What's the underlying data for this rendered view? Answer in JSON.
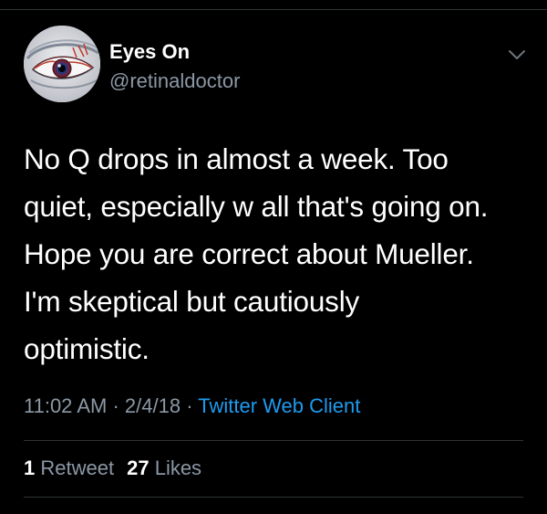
{
  "author": {
    "display_name": "Eyes On",
    "handle": "@retinaldoctor",
    "avatar_icon": "eye-avatar-icon"
  },
  "tweet": {
    "text_lines": [
      "No Q drops in almost a week. Too",
      "quiet, especially w all that's going on.",
      "Hope you are correct about Mueller.",
      "I'm skeptical but cautiously",
      "optimistic."
    ],
    "time": "11:02 AM",
    "date": "2/4/18",
    "separator": "·",
    "client": "Twitter Web Client"
  },
  "stats": {
    "retweet_count": "1",
    "retweet_label": "Retweet",
    "like_count": "27",
    "like_label": "Likes"
  },
  "menu": {
    "icon": "chevron-down-icon"
  },
  "colors": {
    "background": "#000000",
    "primary_text": "#ffffff",
    "secondary_text": "#8b98a5",
    "link": "#1d9bf0",
    "divider": "#2f3336"
  }
}
